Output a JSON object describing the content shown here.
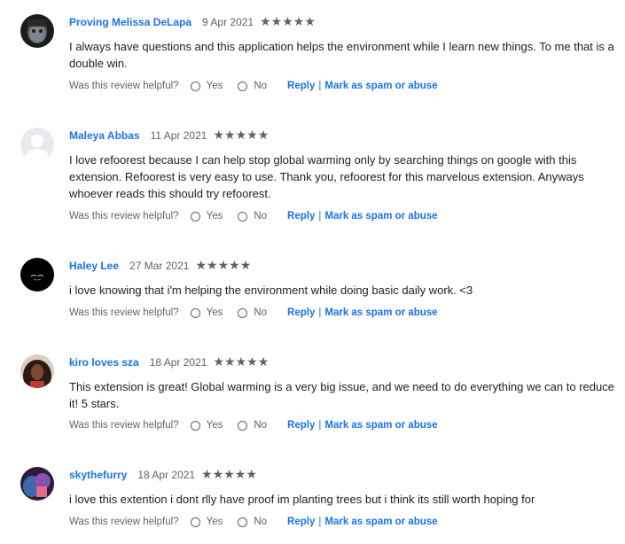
{
  "helpful_prompt": "Was this review helpful?",
  "yes_label": "Yes",
  "no_label": "No",
  "reply_label": "Reply",
  "separator": "|",
  "spam_label": "Mark as spam or abuse",
  "colors": {
    "link": "#1a73e8",
    "muted": "#5f6368",
    "text": "#202124"
  },
  "reviews": [
    {
      "author": "Proving Melissa DeLapa",
      "date": "9 Apr 2021",
      "rating": 5,
      "text": "I always have questions and this application helps the environment while I learn new things. To me that is a double win."
    },
    {
      "author": "Maleya Abbas",
      "date": "11 Apr 2021",
      "rating": 5,
      "text": "I love refoorest because I can help stop global warming only by searching things on google with this extension. Refoorest is very easy to use. Thank you, refoorest for this marvelous extension. Anyways whoever reads this should try refoorest."
    },
    {
      "author": "Haley Lee",
      "date": "27 Mar 2021",
      "rating": 5,
      "text": "i love knowing that i'm helping the environment while doing basic daily work. <3"
    },
    {
      "author": "kiro loves sza",
      "date": "18 Apr 2021",
      "rating": 5,
      "text": "This extension is great! Global warming is a very big issue, and we need to do everything we can to reduce it! 5 stars."
    },
    {
      "author": "skythefurry",
      "date": "18 Apr 2021",
      "rating": 5,
      "text": "i love this extention i dont rlly have proof im planting trees but i think its still worth hoping for"
    }
  ]
}
